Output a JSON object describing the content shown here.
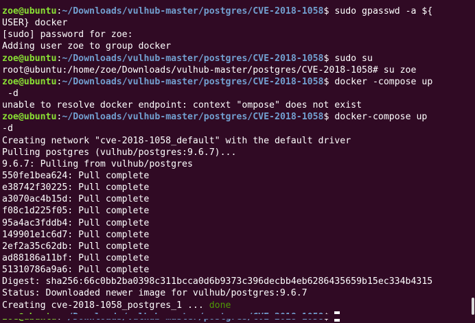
{
  "colors": {
    "background": "#300a24",
    "prompt_user": "#8ae234",
    "prompt_path": "#729fcf",
    "text": "#ffffff",
    "done": "#4e9a06"
  },
  "prompt": {
    "user_host": "zoe@ubuntu",
    "path": "~/Downloads/vulhub-master/postgres/CVE-2018-1058",
    "symbol": "$"
  },
  "lines": [
    {
      "type": "prompt",
      "command": " sudo gpasswd -a ${"
    },
    {
      "type": "text",
      "text": "USER} docker"
    },
    {
      "type": "text",
      "text": "[sudo] password for zoe:"
    },
    {
      "type": "text",
      "text": "Adding user zoe to group docker"
    },
    {
      "type": "prompt",
      "command": " sudo su"
    },
    {
      "type": "text",
      "text": "root@ubuntu:/home/zoe/Downloads/vulhub-master/postgres/CVE-2018-1058# su zoe"
    },
    {
      "type": "prompt",
      "command": " docker -compose up"
    },
    {
      "type": "text",
      "text": " -d"
    },
    {
      "type": "text",
      "text": "unable to resolve docker endpoint: context \"ompose\" does not exist"
    },
    {
      "type": "prompt",
      "command": " docker-compose up"
    },
    {
      "type": "text",
      "text": "-d"
    },
    {
      "type": "text",
      "text": "Creating network \"cve-2018-1058_default\" with the default driver"
    },
    {
      "type": "text",
      "text": "Pulling postgres (vulhub/postgres:9.6.7)..."
    },
    {
      "type": "text",
      "text": "9.6.7: Pulling from vulhub/postgres"
    },
    {
      "type": "text",
      "text": "550fe1bea624: Pull complete"
    },
    {
      "type": "text",
      "text": "e38742f30225: Pull complete"
    },
    {
      "type": "text",
      "text": "a3070ac4b15d: Pull complete"
    },
    {
      "type": "text",
      "text": "f08c1d225f05: Pull complete"
    },
    {
      "type": "text",
      "text": "95a4ac3fddb4: Pull complete"
    },
    {
      "type": "text",
      "text": "149901e1c6d7: Pull complete"
    },
    {
      "type": "text",
      "text": "2ef2a35c62db: Pull complete"
    },
    {
      "type": "text",
      "text": "ad88186a11bf: Pull complete"
    },
    {
      "type": "text",
      "text": "51310786a9a6: Pull complete"
    },
    {
      "type": "text",
      "text": "Digest: sha256:66c0bb2ba0398c311bcca0d6b9373c396decbb4eb6286435659b15ec334b4315"
    },
    {
      "type": "text",
      "text": "Status: Downloaded newer image for vulhub/postgres:9.6.7"
    },
    {
      "type": "status",
      "text": "Creating cve-2018-1058_postgres_1 ... ",
      "status": "done"
    },
    {
      "type": "prompt",
      "command": " ",
      "cursor": true
    }
  ]
}
